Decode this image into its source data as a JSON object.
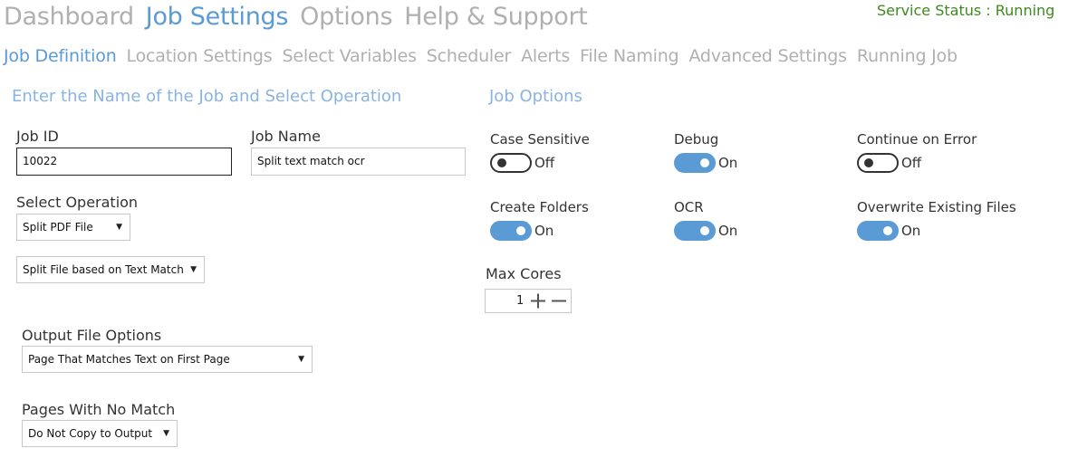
{
  "top_nav": {
    "items": [
      {
        "label": "Dashboard"
      },
      {
        "label": "Job Settings"
      },
      {
        "label": "Options"
      },
      {
        "label": "Help & Support"
      }
    ]
  },
  "service_status": "Service Status : Running",
  "sub_nav": {
    "items": [
      {
        "label": "Job Definition"
      },
      {
        "label": "Location Settings"
      },
      {
        "label": "Select Variables"
      },
      {
        "label": "Scheduler"
      },
      {
        "label": "Alerts"
      },
      {
        "label": "File Naming"
      },
      {
        "label": "Advanced Settings"
      },
      {
        "label": "Running Job"
      }
    ]
  },
  "left_section": {
    "title": "Enter the Name of the Job and Select Operation",
    "job_id": {
      "label": "Job ID",
      "value": "10022"
    },
    "job_name": {
      "label": "Job Name",
      "value": "Split text match ocr"
    },
    "select_operation": {
      "label": "Select Operation",
      "value": "Split PDF File"
    },
    "split_method": {
      "value": "Split File based on Text Match"
    },
    "output_file_options": {
      "label": "Output File Options",
      "value": "Page That Matches Text on First Page"
    },
    "pages_with_no_match": {
      "label": "Pages With No Match",
      "value": "Do Not Copy to Output"
    }
  },
  "job_options": {
    "title": "Job Options",
    "case_sensitive": {
      "label": "Case Sensitive",
      "state": "Off"
    },
    "debug": {
      "label": "Debug",
      "state": "On"
    },
    "continue_on_error": {
      "label": "Continue on Error",
      "state": "Off"
    },
    "create_folders": {
      "label": "Create Folders",
      "state": "On"
    },
    "ocr": {
      "label": "OCR",
      "state": "On"
    },
    "overwrite_existing_files": {
      "label": "Overwrite Existing Files",
      "state": "On"
    },
    "max_cores": {
      "label": "Max Cores",
      "value": "1"
    }
  },
  "colors": {
    "accent": "#5b9bd5",
    "inactive_nav": "#b0b0b0",
    "section_title": "#8ab4df",
    "status_green": "#3d8b1f"
  }
}
